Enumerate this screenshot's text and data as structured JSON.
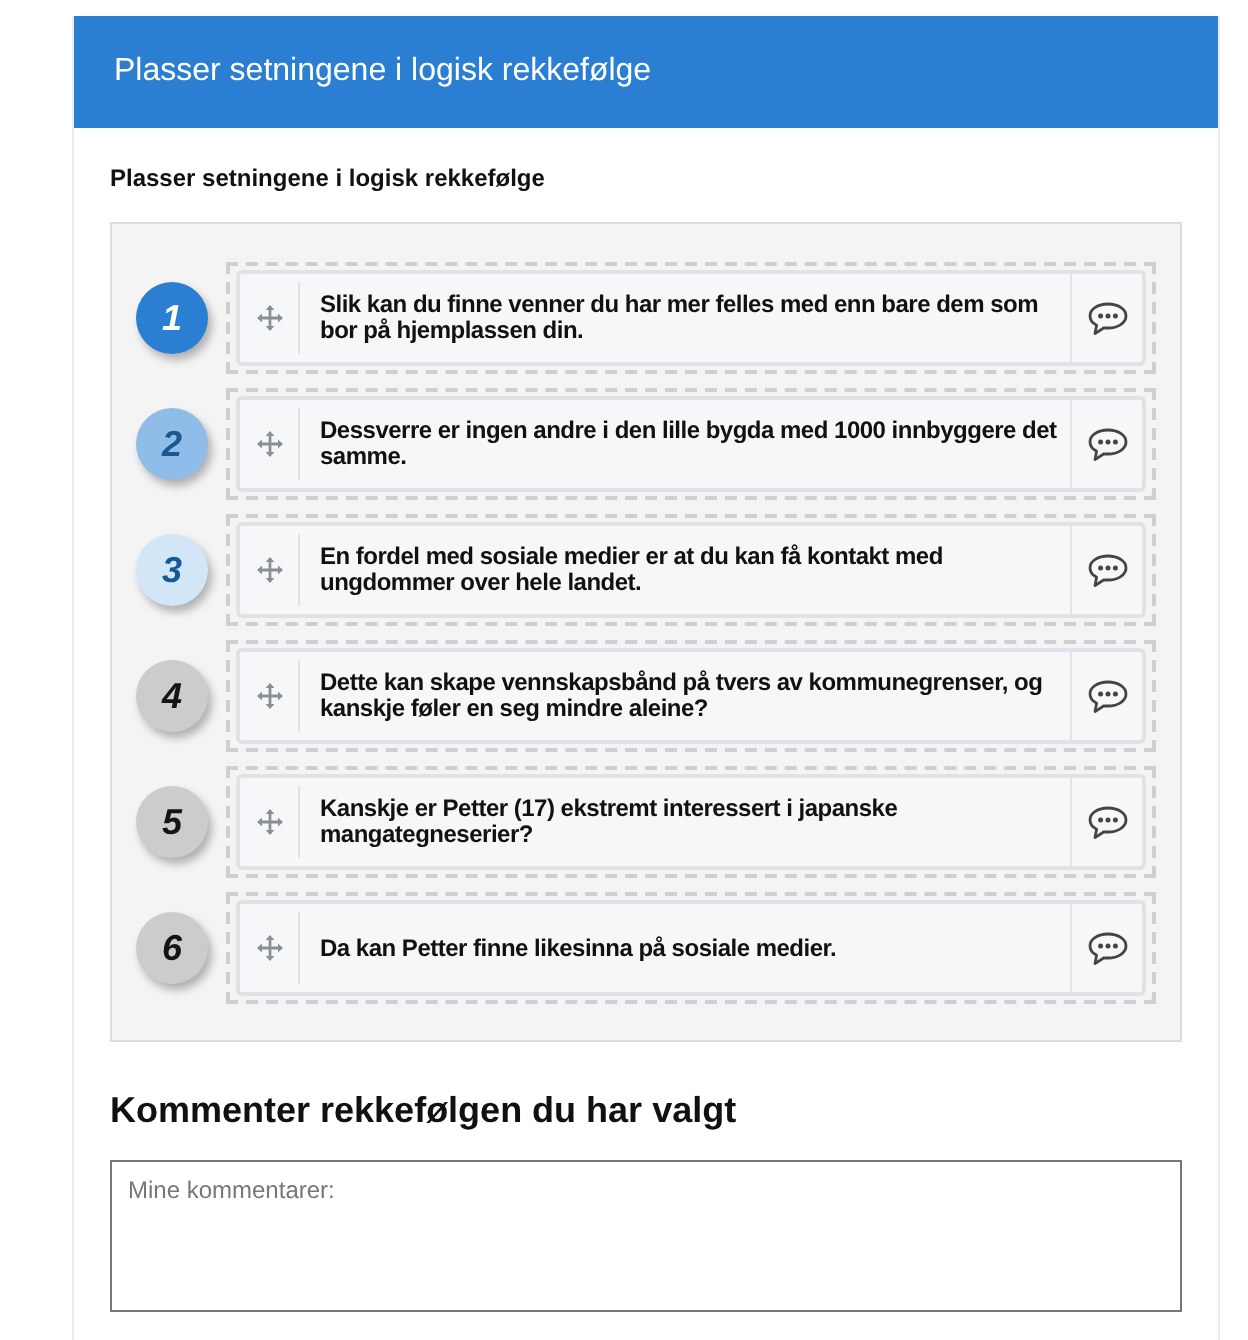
{
  "header": {
    "title": "Plasser setningene i logisk rekkefølge"
  },
  "task": {
    "instruction": "Plasser setningene i logisk rekkefølge",
    "items": [
      {
        "number": "1",
        "color": "#2b7fd3",
        "text": "Slik kan du finne venner du har mer felles med enn bare dem som bor på hjemplassen din."
      },
      {
        "number": "2",
        "color": "#8fbce9",
        "text": "Dessverre er ingen andre i den lille bygda med 1000 innbyggere det samme."
      },
      {
        "number": "3",
        "color": "#d3e6f8",
        "text": "En fordel med sosiale medier er at du kan få kontakt med ungdommer over hele landet."
      },
      {
        "number": "4",
        "color": "#cccccc",
        "text": "Dette kan skape vennskapsbånd på tvers av kommunegrenser, og kanskje føler en seg mindre aleine?"
      },
      {
        "number": "5",
        "color": "#cccccc",
        "text": "Kanskje er Petter (17) ekstremt interessert i japanske mangategneserier?"
      },
      {
        "number": "6",
        "color": "#cccccc",
        "text": "Da kan Petter finne likesinna på sosiale medier."
      }
    ]
  },
  "comment": {
    "heading": "Kommenter rekkefølgen du har valgt",
    "placeholder": "Mine kommentarer:"
  }
}
